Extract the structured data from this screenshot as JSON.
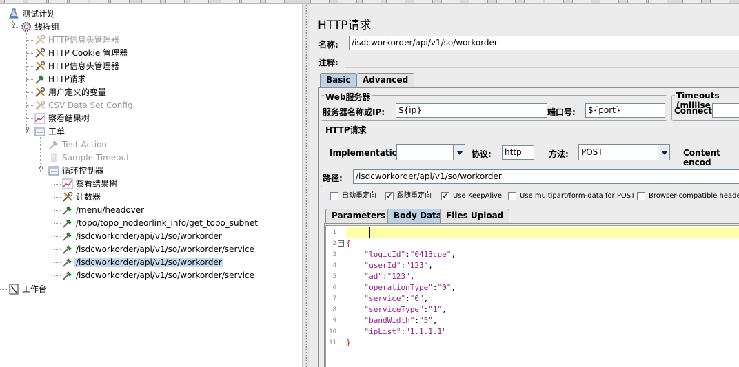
{
  "tree": {
    "nodes": [
      {
        "label": "测试计划",
        "icon": "flask-icon",
        "disabled": false
      },
      {
        "label": "线程组",
        "icon": "gear-icon",
        "disabled": false
      },
      {
        "label": "HTTP信息头管理器",
        "icon": "wrench-icon",
        "disabled": true
      },
      {
        "label": "HTTP Cookie 管理器",
        "icon": "wrench-icon",
        "disabled": false
      },
      {
        "label": "HTTP信息头管理器",
        "icon": "wrench-icon",
        "disabled": false
      },
      {
        "label": "HTTP请求",
        "icon": "pipette-icon",
        "disabled": false
      },
      {
        "label": "用户定义的变量",
        "icon": "wrench-icon",
        "disabled": false
      },
      {
        "label": "CSV Data Set Config",
        "icon": "wrench-icon",
        "disabled": true
      },
      {
        "label": "察看结果树",
        "icon": "chart-icon",
        "disabled": false
      },
      {
        "label": "工单",
        "icon": "folder-icon",
        "disabled": false
      },
      {
        "label": "Test Action",
        "icon": "pipette-icon",
        "disabled": true
      },
      {
        "label": "Sample Timeout",
        "icon": "timer-icon",
        "disabled": true
      },
      {
        "label": "循环控制器",
        "icon": "folder-icon",
        "disabled": false
      },
      {
        "label": "察看结果树",
        "icon": "chart-icon",
        "disabled": false
      },
      {
        "label": "计数器",
        "icon": "wrench-icon",
        "disabled": false
      },
      {
        "label": "/menu/headover",
        "icon": "pipette-icon",
        "disabled": false
      },
      {
        "label": "/topo/topo_nodeorlink_info/get_topo_subnet",
        "icon": "pipette-icon",
        "disabled": false
      },
      {
        "label": "/isdcworkorder/api/v1/so/workorder",
        "icon": "pipette-icon",
        "disabled": false
      },
      {
        "label": "/isdcworkorder/api/v1/so/workorder/service",
        "icon": "pipette-icon",
        "disabled": false
      },
      {
        "label": "/isdcworkorder/api/v1/so/workorder",
        "icon": "pipette-icon",
        "disabled": false,
        "selected": true
      },
      {
        "label": "/isdcworkorder/api/v1/so/workorder/service",
        "icon": "pipette-icon",
        "disabled": false
      }
    ],
    "workbench": "工作台"
  },
  "panel": {
    "title": "HTTP请求",
    "name_label": "名称:",
    "name_value": "/isdcworkorder/api/v1/so/workorder",
    "comment_label": "注释:",
    "comment_value": "",
    "tabs": [
      "Basic",
      "Advanced"
    ],
    "active_tab": "Basic"
  },
  "web_server": {
    "title": "Web服务器",
    "server_label": "服务器名称或IP:",
    "server_value": "${ip}",
    "port_label": "端口号:",
    "port_value": "${port}"
  },
  "timeouts": {
    "title": "Timeouts (millise",
    "connect_label": "Connect:",
    "connect_value": ""
  },
  "http_request": {
    "title": "HTTP请求",
    "implementation_label": "Implementation:",
    "implementation_value": "",
    "protocol_label": "协议:",
    "protocol_value": "http",
    "method_label": "方法:",
    "method_value": "POST",
    "content_encoding_label": "Content encod",
    "path_label": "路径:",
    "path_value": "/isdcworkorder/api/v1/so/workorder"
  },
  "options": [
    {
      "label": "自动重定向",
      "checked": false
    },
    {
      "label": "跟随重定向",
      "checked": true
    },
    {
      "label": "Use KeepAlive",
      "checked": true
    },
    {
      "label": "Use multipart/form-data for POST",
      "checked": false
    },
    {
      "label": "Browser-compatible headers",
      "checked": false
    }
  ],
  "subtabs": [
    "Parameters",
    "Body Data",
    "Files Upload"
  ],
  "active_subtab": "Body Data",
  "editor": {
    "line_numbers": [
      "1",
      "2",
      "3",
      "4",
      "5",
      "6",
      "7",
      "8",
      "9",
      "10",
      "11"
    ],
    "lines": [
      "",
      "{",
      "    \"logicId\":\"0413cpe\",",
      "    \"userId\":\"123\",",
      "    \"ad\":\"123\",",
      "    \"operationType\":\"0\",",
      "    \"service\":\"0\",",
      "    \"serviceType\":\"1\",",
      "    \"bandWidth\":\"5\",",
      "    \"ipList\":\"1.1.1.1\"",
      "}"
    ]
  },
  "colors": {
    "selection": "#c7d9ee",
    "active_tab": "#bcd0e6",
    "current_line": "#ffffaa",
    "json_string": "#9a1b8a",
    "json_brace": "#d01010"
  }
}
